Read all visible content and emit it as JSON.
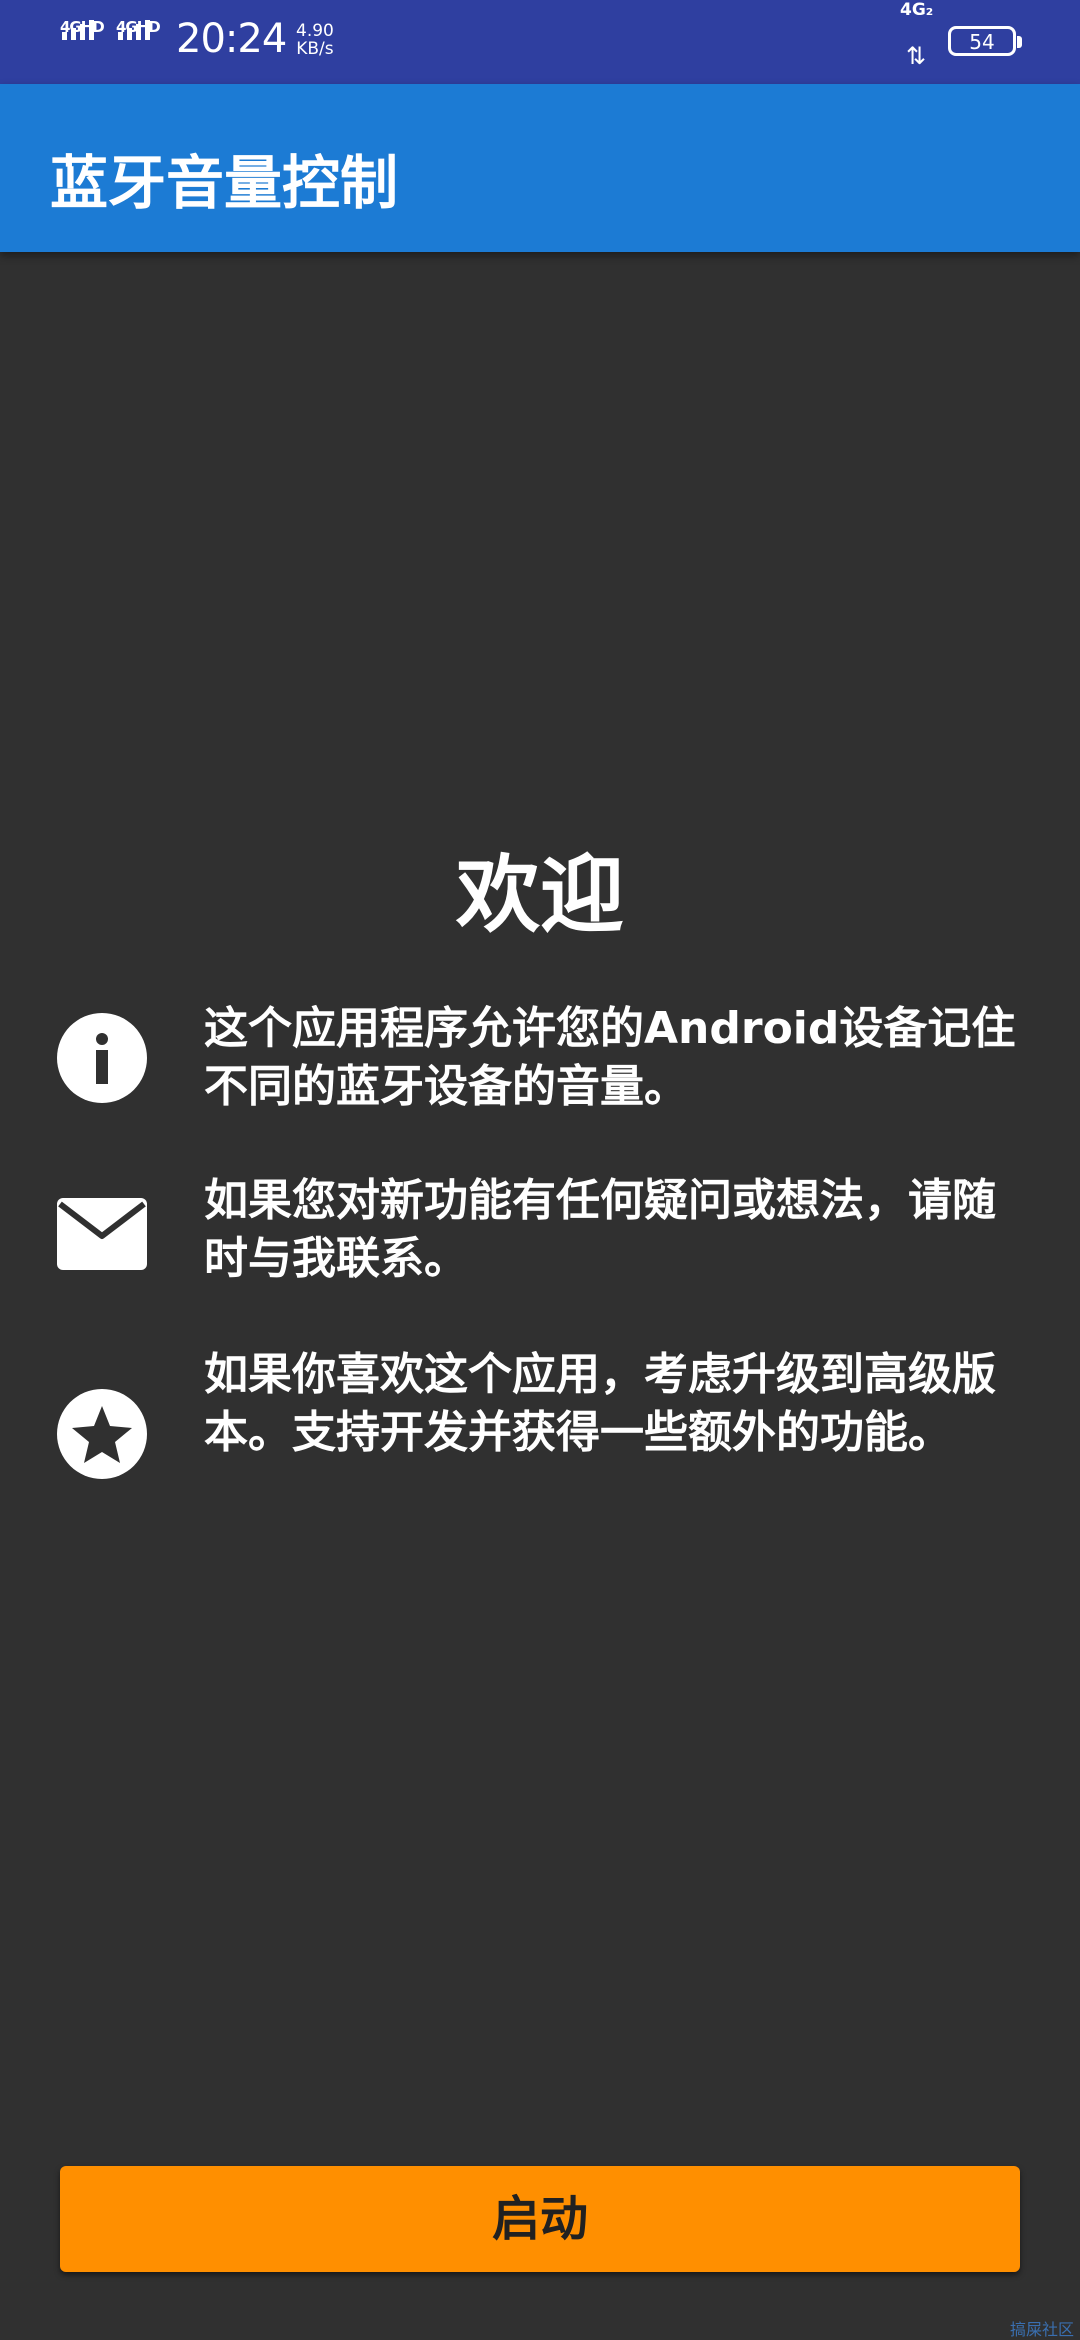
{
  "status_bar": {
    "sim1": "4GHD",
    "sim2": "4GHD",
    "time": "20:24",
    "speed_value": "4.90",
    "speed_unit": "KB/s",
    "network": "4G₂",
    "battery": "54"
  },
  "app_bar": {
    "title": "蓝牙音量控制"
  },
  "main": {
    "heading": "欢迎",
    "items": [
      {
        "icon": "info-icon",
        "text": "这个应用程序允许您的Android设备记住不同的蓝牙设备的音量。"
      },
      {
        "icon": "mail-icon",
        "text": "如果您对新功能有任何疑问或想法，请随时与我联系。"
      },
      {
        "icon": "star-icon",
        "text": "如果你喜欢这个应用，考虑升级到高级版本。支持开发并获得一些额外的功能。"
      }
    ]
  },
  "start_button": {
    "label": "启动"
  },
  "watermark": "搞屎社区",
  "colors": {
    "status_bar": "#2f3fa0",
    "app_bar": "#1c7bd4",
    "background": "#303030",
    "button": "#ff8f00"
  }
}
